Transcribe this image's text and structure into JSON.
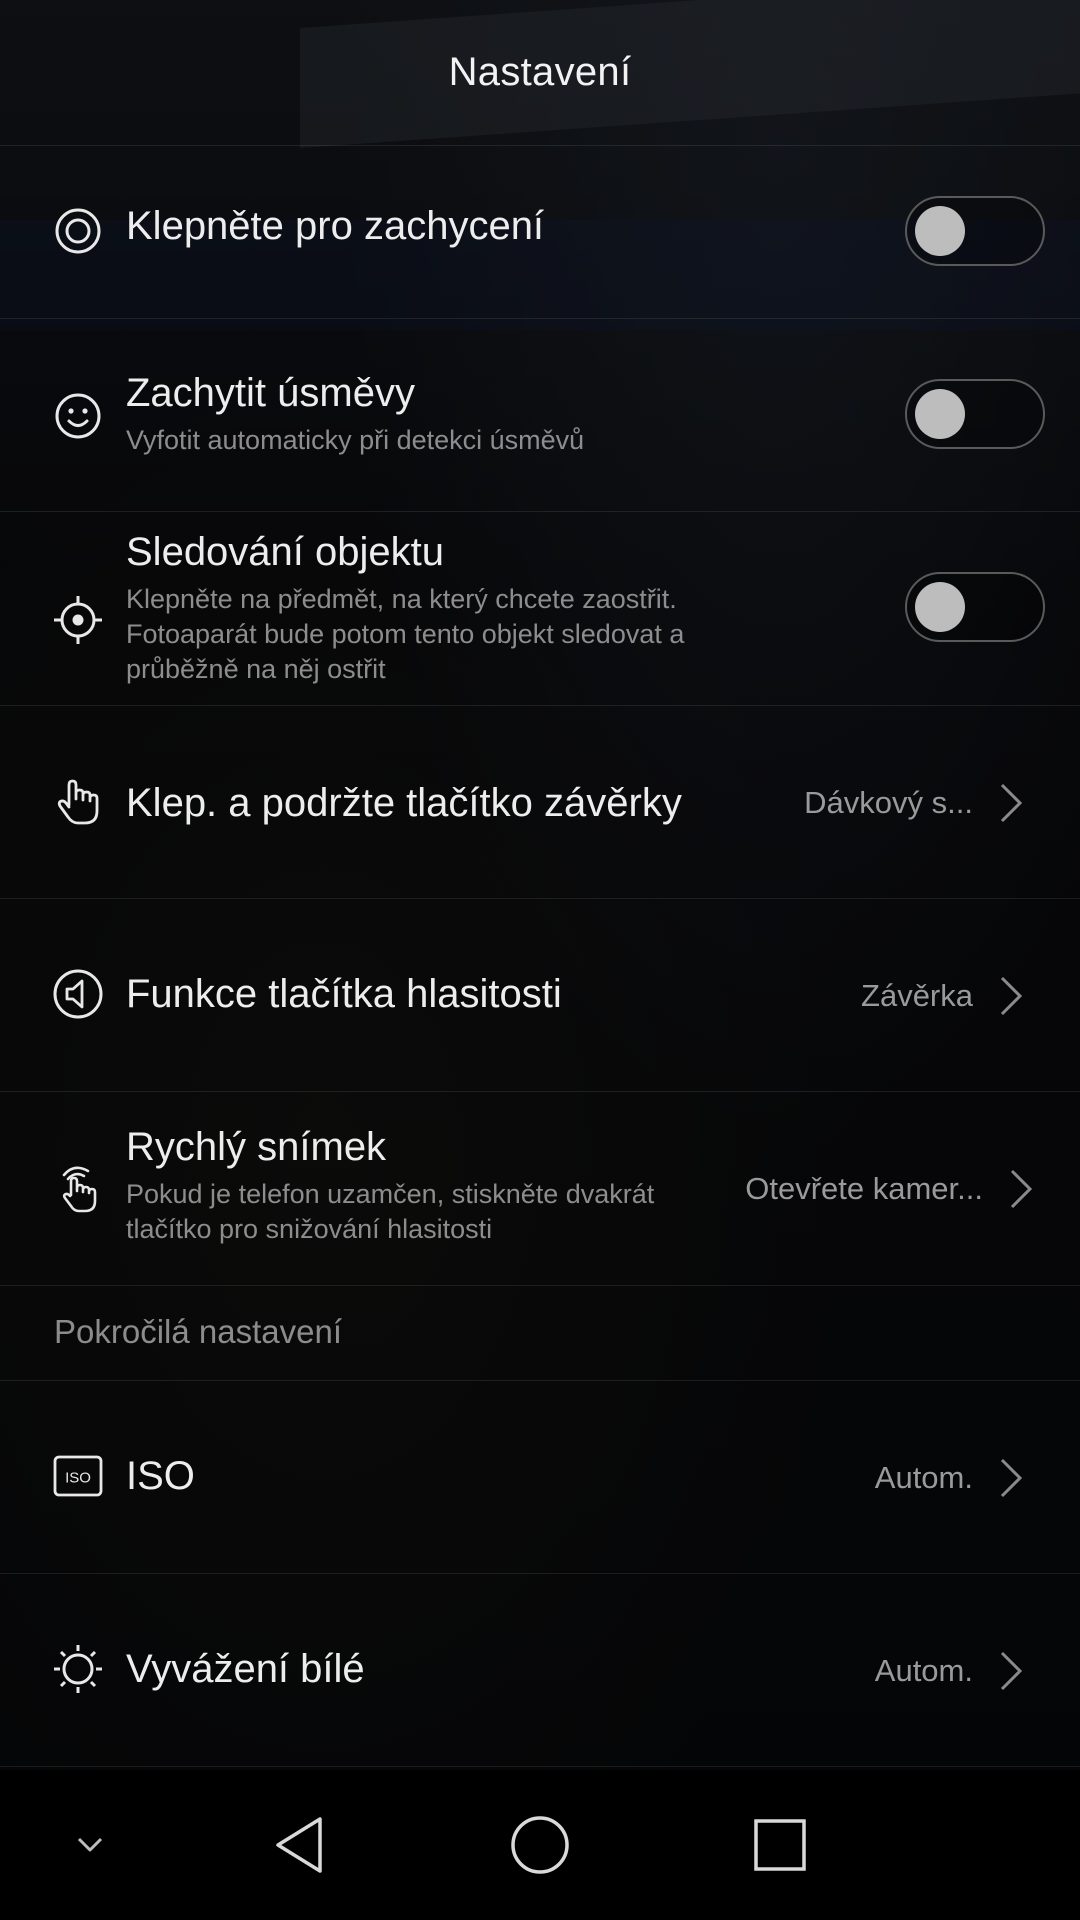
{
  "header": {
    "title": "Nastavení"
  },
  "settings": [
    {
      "title": "Klepněte pro zachycení",
      "toggle_on": false,
      "icon": "tap-capture-icon"
    },
    {
      "title": "Zachytit úsměvy",
      "description": "Vyfotit automaticky při detekci úsměvů",
      "toggle_on": false,
      "icon": "smile-icon"
    },
    {
      "title": "Sledování objektu",
      "description": "Klepněte na předmět, na který chcete zaostřit. Fotoaparát bude potom tento objekt sledovat a průběžně na něj ostřit",
      "toggle_on": false,
      "icon": "crosshair-icon"
    },
    {
      "title": "Klep. a podržte tlačítko závěrky",
      "value": "Dávkový s...",
      "icon": "hand-icon"
    },
    {
      "title": "Funkce tlačítka hlasitosti",
      "value": "Závěrka",
      "icon": "speaker-icon"
    },
    {
      "title": "Rychlý snímek",
      "description": "Pokud je telefon uzamčen, stiskněte dvakrát tlačítko pro snižování hlasitosti",
      "value": "Otevřete kamer...",
      "icon": "double-tap-hand-icon"
    }
  ],
  "advanced": {
    "section_label": "Pokročilá nastavení",
    "items": [
      {
        "title": "ISO",
        "value": "Autom.",
        "icon": "iso-icon"
      },
      {
        "title": "Vyvážení bílé",
        "value": "Autom.",
        "icon": "white-balance-icon"
      }
    ]
  },
  "navbar": {
    "buttons": [
      "collapse-chevron-icon",
      "back-icon",
      "home-icon",
      "recents-icon"
    ]
  },
  "colors": {
    "background": "#08090b",
    "title_text": "#ededed",
    "secondary_text": "#8d8d8d",
    "toggle_knob": "#bdbdbd"
  }
}
